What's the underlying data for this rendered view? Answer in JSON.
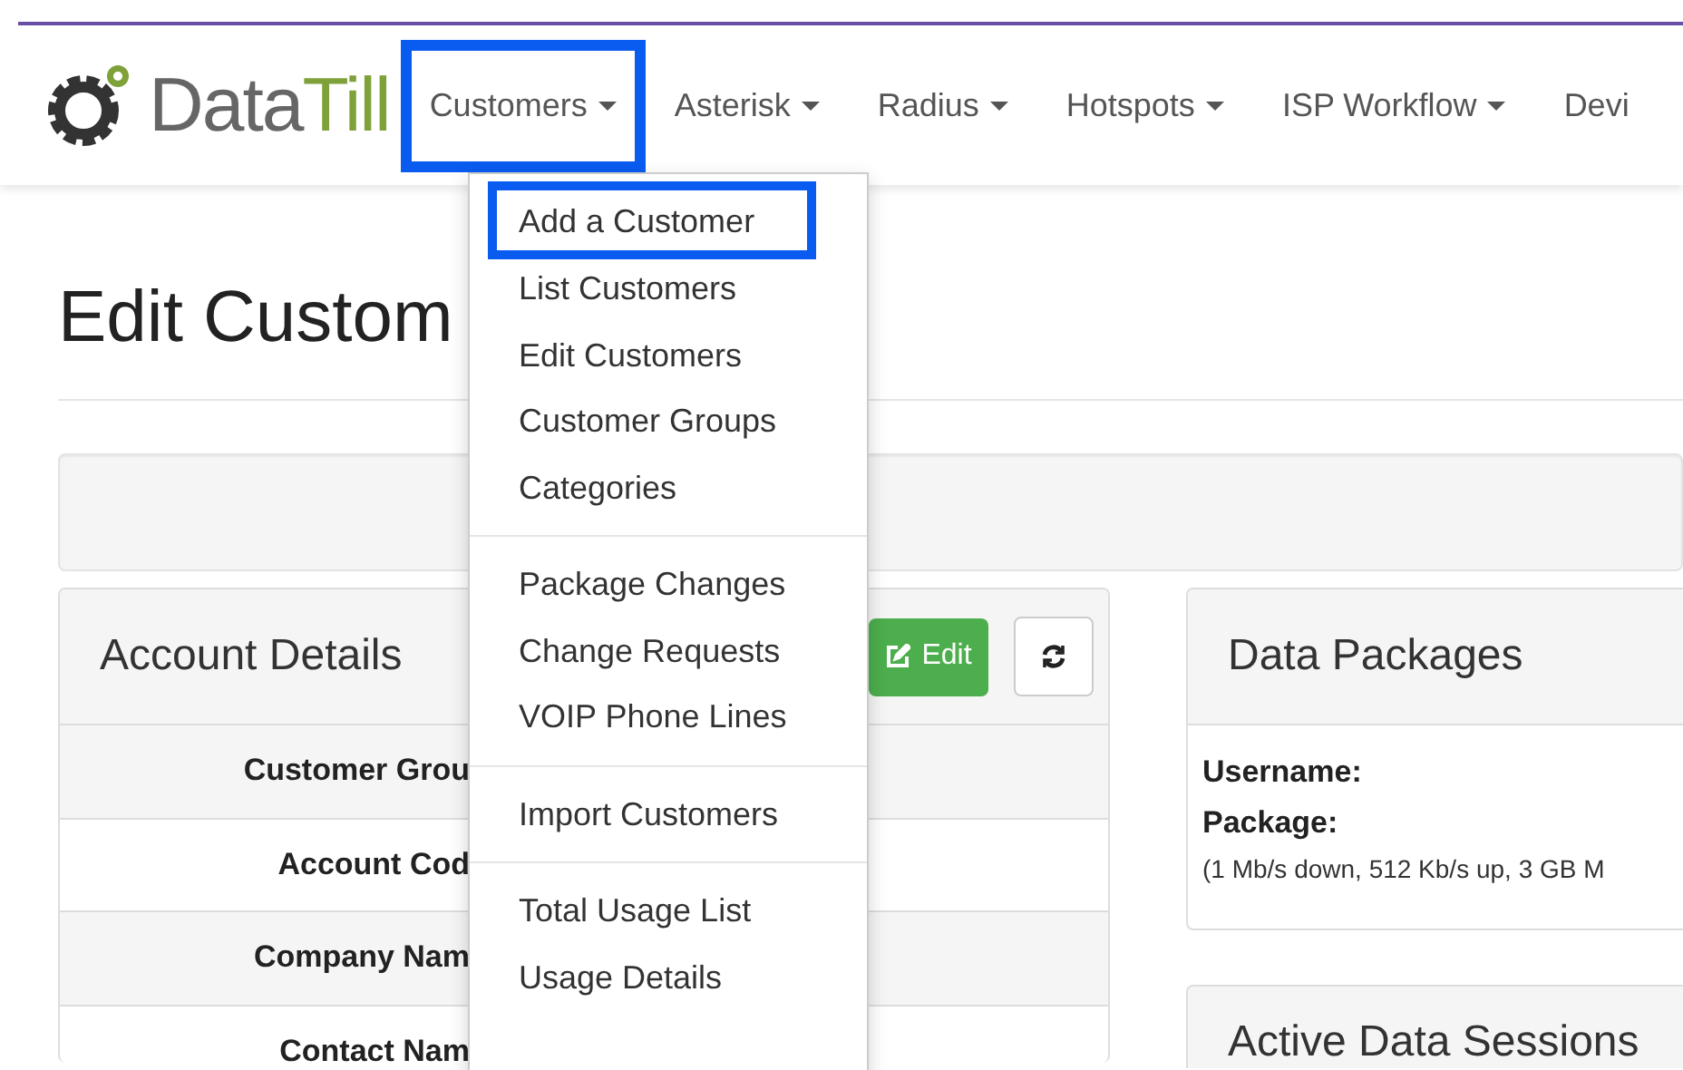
{
  "brand": {
    "part_1": "Data",
    "part_2": "Till"
  },
  "nav": [
    {
      "label": "Customers",
      "selected": true
    },
    {
      "label": "Asterisk",
      "selected": false
    },
    {
      "label": "Radius",
      "selected": false
    },
    {
      "label": "Hotspots",
      "selected": false
    },
    {
      "label": "ISP Workflow",
      "selected": false
    },
    {
      "label": "Devi",
      "selected": false
    }
  ],
  "dropdown": {
    "groups": [
      {
        "items": [
          {
            "label": "Add a Customer",
            "selected": true
          },
          {
            "label": "List Customers",
            "selected": false
          },
          {
            "label": "Edit Customers",
            "selected": false
          },
          {
            "label": "Customer Groups",
            "selected": false
          },
          {
            "label": "Categories",
            "selected": false
          }
        ]
      },
      {
        "items": [
          {
            "label": "Package Changes",
            "selected": false
          },
          {
            "label": "Change Requests",
            "selected": false
          },
          {
            "label": "VOIP Phone Lines",
            "selected": false
          }
        ]
      },
      {
        "items": [
          {
            "label": "Import Customers",
            "selected": false
          }
        ]
      },
      {
        "items": [
          {
            "label": "Total Usage List",
            "selected": false
          },
          {
            "label": "Usage Details",
            "selected": false
          }
        ]
      }
    ]
  },
  "page_title": "Edit Custom",
  "account_panel": {
    "title": "Account Details",
    "edit_button": "Edit",
    "rows": [
      "Customer Grou",
      "Account Cod",
      "Company Nam",
      "Contact Nam"
    ]
  },
  "data_packages": {
    "title": "Data Packages",
    "username_label": "Username:",
    "package_label": "Package:",
    "package_detail": "(1 Mb/s down, 512 Kb/s up, 3 GB M"
  },
  "sessions_panel": {
    "title": "Active Data Sessions"
  }
}
